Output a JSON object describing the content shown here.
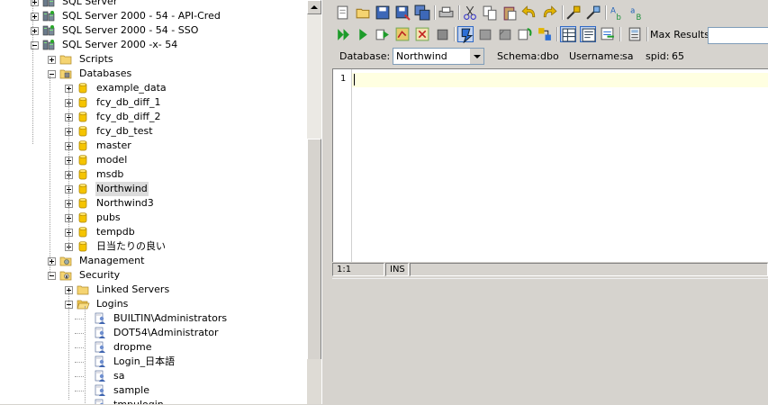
{
  "tree": {
    "nodes": [
      {
        "label": "SQL Server",
        "depth": 1,
        "icon": "server-group-icon",
        "expander": "plus"
      },
      {
        "label": "SQL Server 2000 - 54 - API-Cred",
        "depth": 1,
        "icon": "server-icon",
        "expander": "plus"
      },
      {
        "label": "SQL Server 2000 - 54 - SSO",
        "depth": 1,
        "icon": "server-icon",
        "expander": "plus"
      },
      {
        "label": "SQL Server 2000 -x- 54",
        "depth": 1,
        "icon": "server-icon",
        "expander": "minus"
      },
      {
        "label": "Scripts",
        "depth": 2,
        "icon": "folder-icon",
        "expander": "plus"
      },
      {
        "label": "Databases",
        "depth": 2,
        "icon": "databases-folder-icon",
        "expander": "minus"
      },
      {
        "label": "example_data",
        "depth": 3,
        "icon": "database-icon",
        "expander": "plus"
      },
      {
        "label": "fcy_db_diff_1",
        "depth": 3,
        "icon": "database-icon",
        "expander": "plus"
      },
      {
        "label": "fcy_db_diff_2",
        "depth": 3,
        "icon": "database-icon",
        "expander": "plus"
      },
      {
        "label": "fcy_db_test",
        "depth": 3,
        "icon": "database-icon",
        "expander": "plus"
      },
      {
        "label": "master",
        "depth": 3,
        "icon": "database-icon",
        "expander": "plus"
      },
      {
        "label": "model",
        "depth": 3,
        "icon": "database-icon",
        "expander": "plus"
      },
      {
        "label": "msdb",
        "depth": 3,
        "icon": "database-icon",
        "expander": "plus"
      },
      {
        "label": "Northwind",
        "depth": 3,
        "icon": "database-icon",
        "expander": "plus",
        "selected": true
      },
      {
        "label": "Northwind3",
        "depth": 3,
        "icon": "database-icon",
        "expander": "plus"
      },
      {
        "label": "pubs",
        "depth": 3,
        "icon": "database-icon",
        "expander": "plus"
      },
      {
        "label": "tempdb",
        "depth": 3,
        "icon": "database-icon",
        "expander": "plus"
      },
      {
        "label": "日当たりの良い",
        "depth": 3,
        "icon": "database-icon",
        "expander": "plus"
      },
      {
        "label": "Management",
        "depth": 2,
        "icon": "management-icon",
        "expander": "plus"
      },
      {
        "label": "Security",
        "depth": 2,
        "icon": "security-icon",
        "expander": "minus"
      },
      {
        "label": "Linked Servers",
        "depth": 3,
        "icon": "folder-icon",
        "expander": "plus"
      },
      {
        "label": "Logins",
        "depth": 3,
        "icon": "folder-open-icon",
        "expander": "minus"
      },
      {
        "label": "BUILTIN\\Administrators",
        "depth": 4,
        "icon": "login-icon",
        "expander": "none"
      },
      {
        "label": "DOT54\\Administrator",
        "depth": 4,
        "icon": "login-icon",
        "expander": "none"
      },
      {
        "label": "dropme",
        "depth": 4,
        "icon": "login-icon",
        "expander": "none"
      },
      {
        "label": "Login_日本語",
        "depth": 4,
        "icon": "login-icon",
        "expander": "none"
      },
      {
        "label": "sa",
        "depth": 4,
        "icon": "login-icon",
        "expander": "none"
      },
      {
        "label": "sample",
        "depth": 4,
        "icon": "login-icon",
        "expander": "none"
      },
      {
        "label": "tmpulogin",
        "depth": 4,
        "icon": "login-icon",
        "expander": "none"
      }
    ]
  },
  "toolbar1": {
    "buttons": [
      {
        "name": "new-query-icon"
      },
      {
        "name": "open-folder-icon"
      },
      {
        "name": "save-icon"
      },
      {
        "name": "save-as-icon"
      },
      {
        "name": "save-all-icon"
      },
      {
        "name": "print-icon"
      },
      {
        "name": "cut-icon"
      },
      {
        "name": "copy-icon"
      },
      {
        "name": "paste-icon"
      },
      {
        "name": "undo-icon"
      },
      {
        "name": "redo-icon"
      },
      {
        "name": "find-icon"
      },
      {
        "name": "find-replace-icon"
      },
      {
        "name": "format-sql-icon"
      },
      {
        "name": "unformat-sql-icon"
      }
    ]
  },
  "toolbar2": {
    "buttons": [
      {
        "name": "execute-all-icon"
      },
      {
        "name": "execute-icon"
      },
      {
        "name": "execute-current-icon"
      },
      {
        "name": "explain-plan-icon"
      },
      {
        "name": "execute-script-icon"
      },
      {
        "name": "stop-icon"
      },
      {
        "name": "auto-commit-icon",
        "pressed": true
      },
      {
        "name": "commit-icon"
      },
      {
        "name": "rollback-icon"
      },
      {
        "name": "refresh-icon"
      },
      {
        "name": "query-builder-icon"
      },
      {
        "name": "grid-results-icon",
        "pressed": true
      },
      {
        "name": "text-results-icon",
        "pressed": true
      },
      {
        "name": "export-icon"
      },
      {
        "name": "calculator-icon"
      }
    ],
    "max_results_label": "Max Results:",
    "max_results_value": ""
  },
  "infobar": {
    "database_label": "Database:",
    "database_value": "Northwind",
    "schema_label": "Schema:",
    "schema_value": "dbo",
    "username_label": "Username:",
    "username_value": "sa",
    "spid_label": "spid:",
    "spid_value": "65"
  },
  "editor": {
    "line_number": "1",
    "content": ""
  },
  "statusbar": {
    "position": "1:1",
    "mode": "INS"
  },
  "colors": {
    "current_line": "#ffffe1",
    "selection_blue": "#316ac5",
    "panel_bg": "#d6d3ce"
  }
}
